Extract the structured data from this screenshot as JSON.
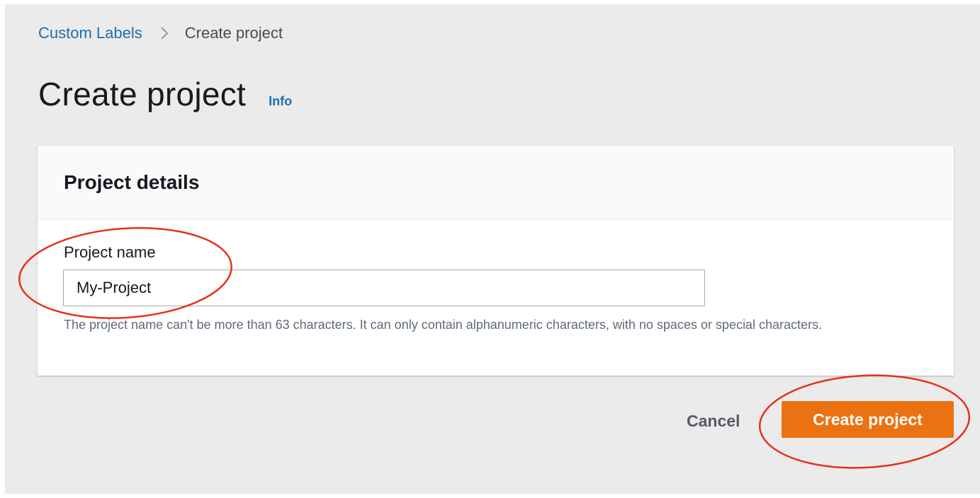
{
  "breadcrumb": {
    "root": "Custom Labels",
    "current": "Create project"
  },
  "page": {
    "title": "Create project",
    "info_link": "Info"
  },
  "panel": {
    "title": "Project details",
    "project_name": {
      "label": "Project name",
      "value": "My-Project",
      "hint": "The project name can't be more than 63 characters. It can only contain alphanumeric characters, with no spaces or special characters."
    }
  },
  "actions": {
    "cancel_label": "Cancel",
    "create_label": "Create project"
  },
  "colors": {
    "accent": "#ec7211",
    "link": "#1b6fb0",
    "annotation": "#e8301c"
  }
}
